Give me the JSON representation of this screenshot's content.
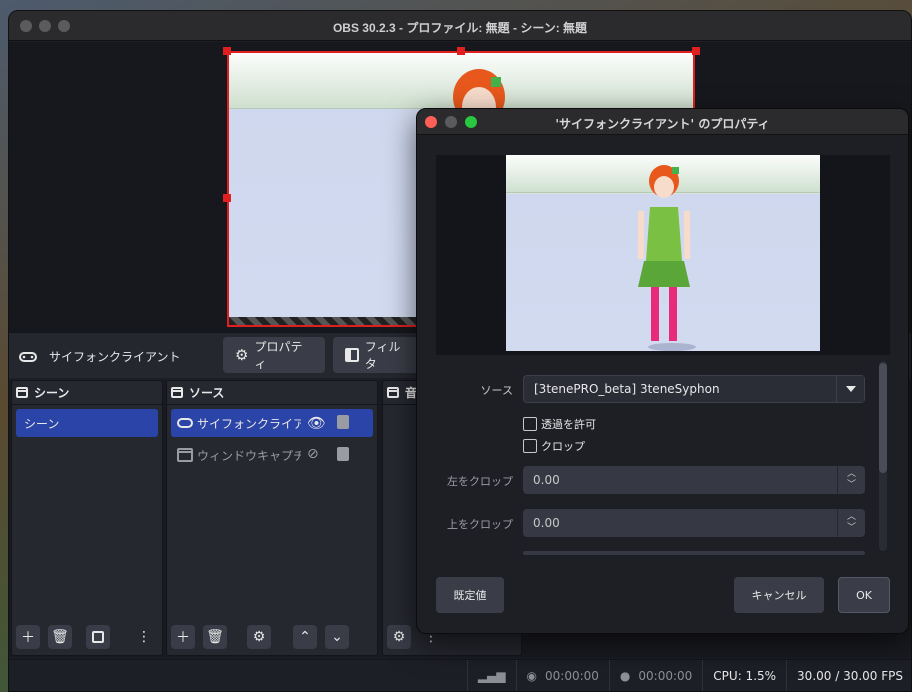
{
  "main_window": {
    "title": "OBS 30.2.3 - プロファイル: 無題 - シーン: 無題"
  },
  "source_toolbar": {
    "source_name": "サイフォンクライアント",
    "properties_label": "プロパティ",
    "filters_label": "フィルタ"
  },
  "scenes_dock": {
    "title": "シーン",
    "items": [
      {
        "label": "シーン",
        "selected": true
      }
    ]
  },
  "sources_dock": {
    "title": "ソース",
    "items": [
      {
        "label": "サイフォンクライア:",
        "icon": "gamepad-icon",
        "visible": true,
        "locked": true,
        "selected": true
      },
      {
        "label": "ウィンドウキャプチ・",
        "icon": "window-icon",
        "visible": false,
        "locked": true,
        "selected": false
      }
    ]
  },
  "audio_dock": {
    "title": "音"
  },
  "statusbar": {
    "stream_time": "00:00:00",
    "record_time": "00:00:00",
    "cpu": "CPU: 1.5%",
    "fps": "30.00 / 30.00 FPS"
  },
  "dialog": {
    "title": "'サイフォンクライアント' のプロパティ",
    "source_label": "ソース",
    "source_value": "[3tenePRO_beta] 3teneSyphon",
    "allow_transparency_label": "透過を許可",
    "crop_label": "クロップ",
    "crop_left_label": "左をクロップ",
    "crop_left_value": "0.00",
    "crop_top_label": "上をクロップ",
    "crop_top_value": "0.00",
    "defaults_label": "既定値",
    "cancel_label": "キャンセル",
    "ok_label": "OK"
  },
  "colors": {
    "accent_selection": "#2b44a8",
    "selection_border": "#e02020",
    "background": "#1d1f26"
  }
}
